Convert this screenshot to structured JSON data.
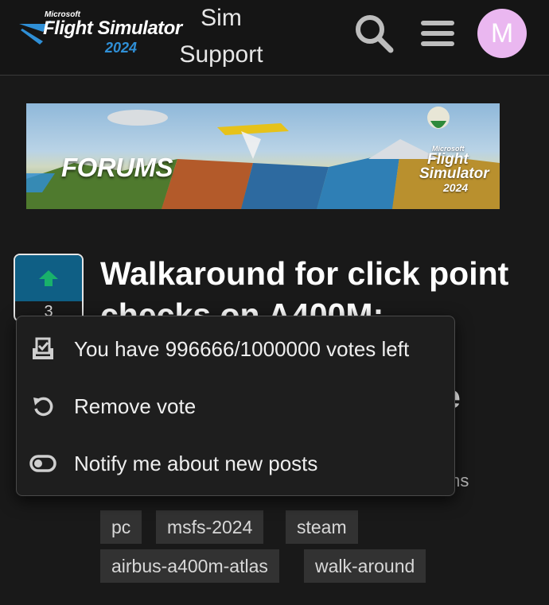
{
  "header": {
    "logo": {
      "brand": "Microsoft",
      "product": "Flight Simulator",
      "year": "2024"
    },
    "section_title": "Sim Support",
    "search_icon": "search-icon",
    "menu_icon": "hamburger-menu-icon",
    "avatar_letter": "M"
  },
  "banner": {
    "label": "FORUMS",
    "logo": {
      "brand": "Microsoft",
      "line1": "Flight",
      "line2": "Simulator",
      "year": "2024"
    }
  },
  "vote": {
    "count": "3",
    "icon": "arrow-up-icon"
  },
  "topic": {
    "title_line1": "Walkaround for click point",
    "title_line2": "checks on A400M:",
    "title_fragment": "e",
    "category_fragment": "ms"
  },
  "tags": [
    "pc",
    "msfs-2024",
    "steam",
    "airbus-a400m-atlas",
    "walk-around"
  ],
  "vote_menu": {
    "items": [
      {
        "label": "You have 996666/1000000 votes left",
        "icon": "ballot-box-icon"
      },
      {
        "label": "Remove vote",
        "icon": "undo-icon"
      },
      {
        "label": "Notify me about new posts",
        "icon": "toggle-icon"
      }
    ]
  },
  "colors": {
    "background": "#191919",
    "vote_button": "#0f5f85",
    "vote_arrow": "#19b16b",
    "avatar": "#eab7f0",
    "logo_blue": "#2f8fd6"
  }
}
